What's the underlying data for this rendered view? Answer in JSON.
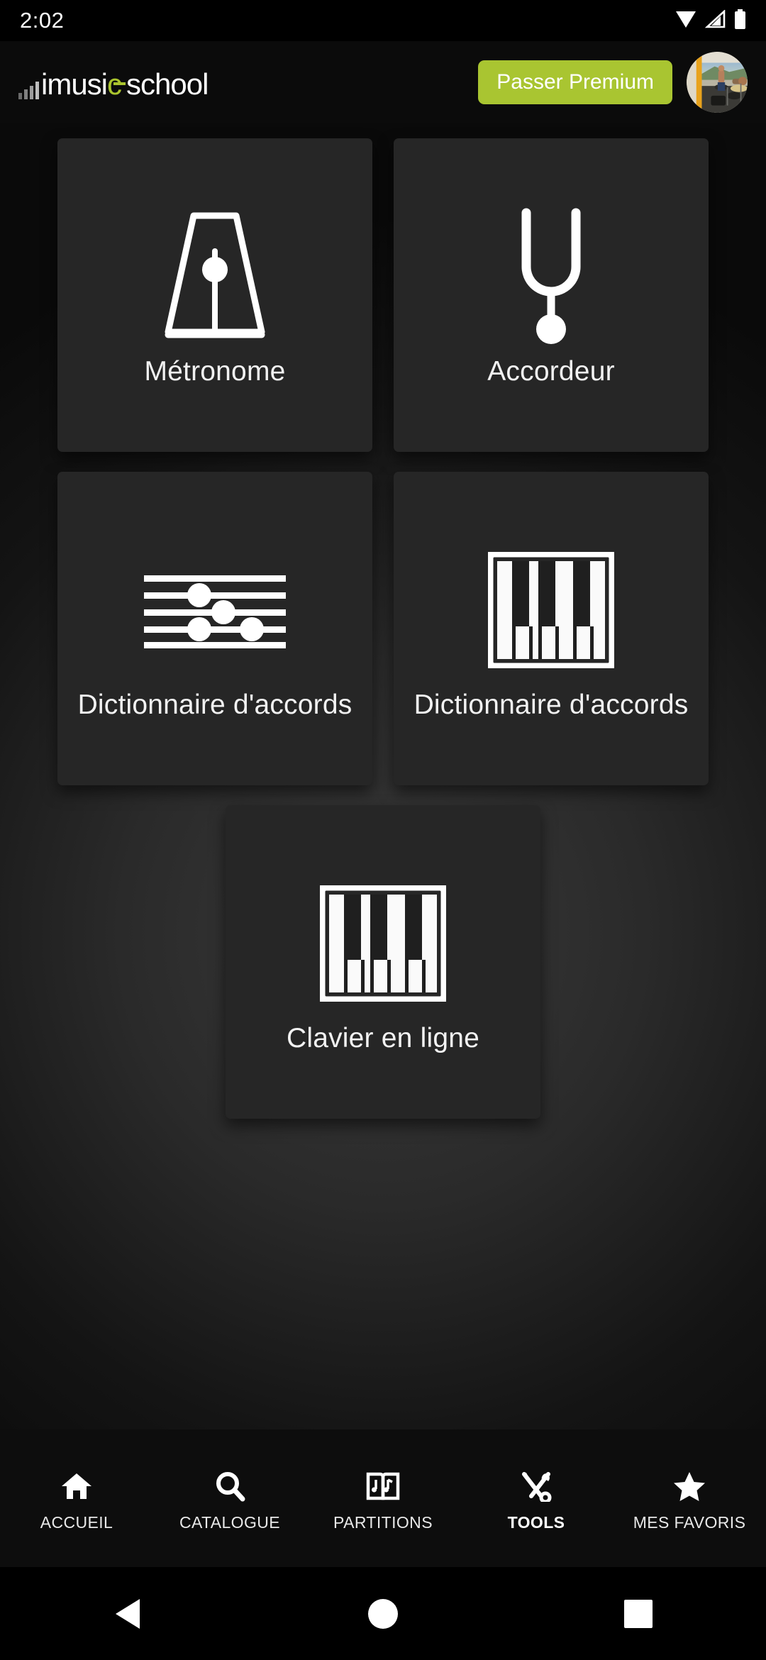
{
  "status_bar": {
    "time": "2:02",
    "icons": [
      "wifi-icon",
      "cellular-signal-icon",
      "battery-icon"
    ]
  },
  "header": {
    "logo": {
      "full_text": "imusic-school",
      "part_1": "imusi",
      "accent_letter": "c",
      "part_2": "school",
      "accent_color": "#aac42e",
      "bars_icon": "equalizer-bars-icon"
    },
    "premium_button": {
      "label": "Passer Premium",
      "background_color": "#a9c531",
      "text_color": "#ffffff"
    },
    "avatar": {
      "alt": "user-profile-photo",
      "description": "drummer performing under a tent"
    }
  },
  "tools_grid": {
    "cards": [
      {
        "label": "Métronome",
        "icon": "metronome-icon"
      },
      {
        "label": "Accordeur",
        "icon": "tuning-fork-icon"
      },
      {
        "label": "Dictionnaire d'accords",
        "icon": "music-staff-notes-icon"
      },
      {
        "label": "Dictionnaire d'accords",
        "icon": "piano-keyboard-icon"
      },
      {
        "label": "Clavier en ligne",
        "icon": "piano-keyboard-icon"
      }
    ]
  },
  "bottom_nav": {
    "items": [
      {
        "label": "ACCUEIL",
        "icon": "home-icon",
        "active": false
      },
      {
        "label": "CATALOGUE",
        "icon": "search-icon",
        "active": false
      },
      {
        "label": "PARTITIONS",
        "icon": "sheet-music-icon",
        "active": false
      },
      {
        "label": "TOOLS",
        "icon": "tools-icon",
        "active": true
      },
      {
        "label": "MES FAVORIS",
        "icon": "star-icon",
        "active": false
      }
    ]
  },
  "system_nav": {
    "back": "back-triangle-icon",
    "home": "home-circle-icon",
    "recents": "recents-square-icon"
  }
}
